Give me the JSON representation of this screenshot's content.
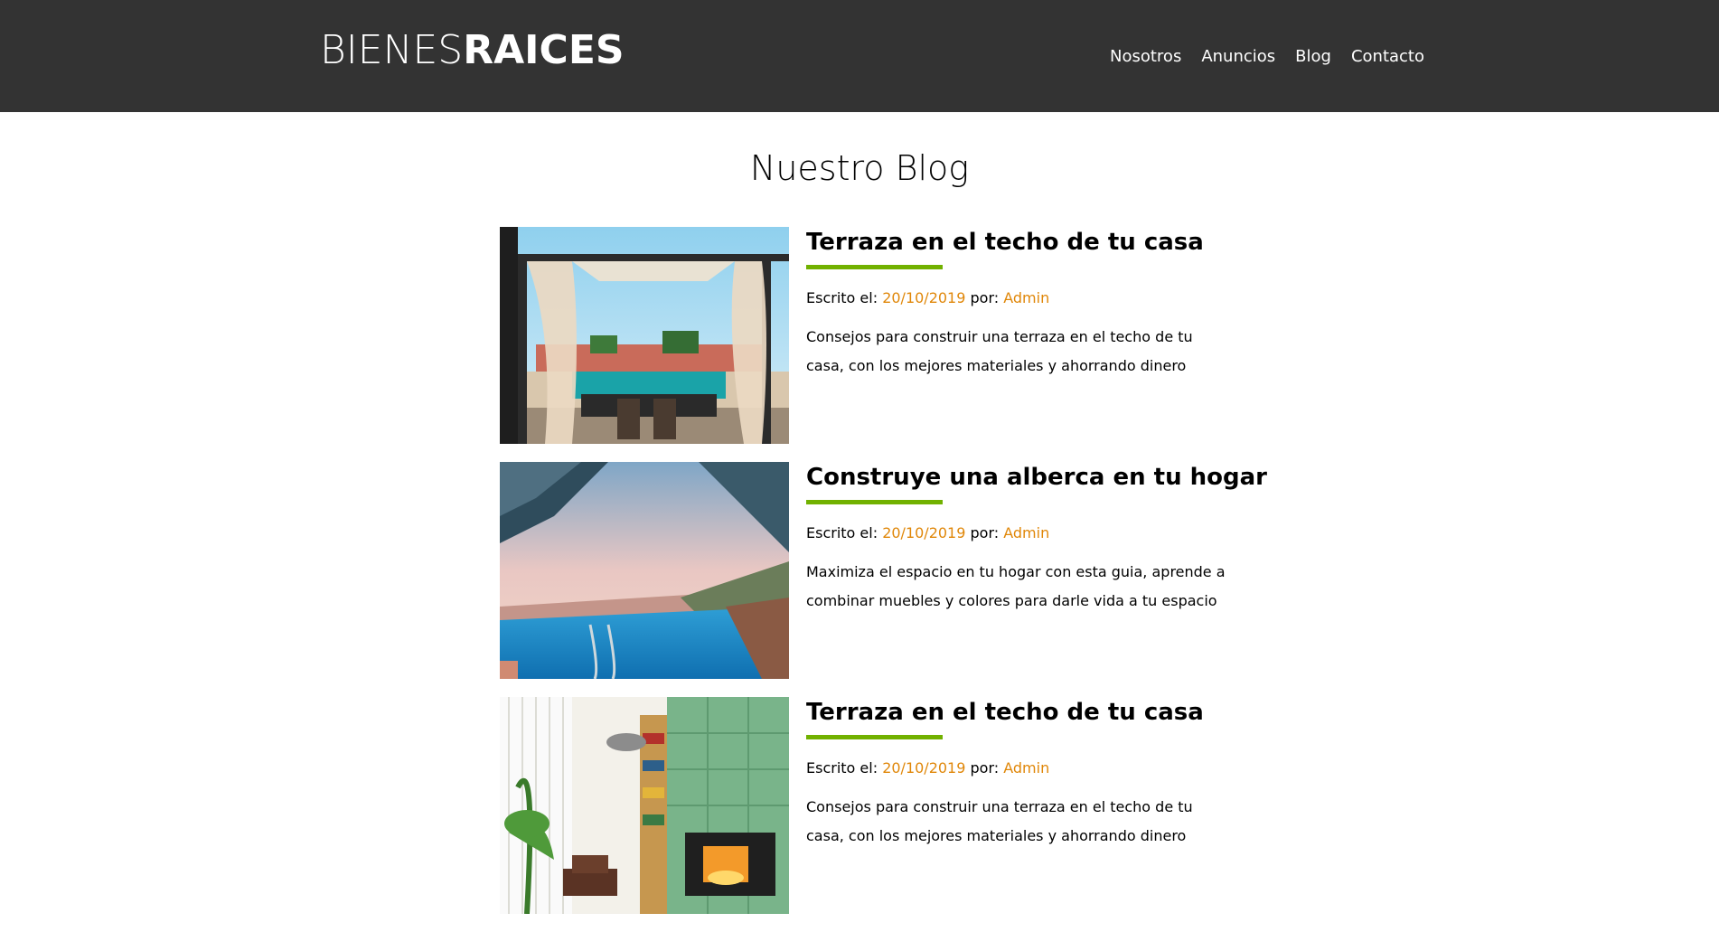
{
  "header": {
    "logo_thin": "BIENES",
    "logo_bold": "RAICES",
    "nav": [
      "Nosotros",
      "Anuncios",
      "Blog",
      "Contacto"
    ]
  },
  "page": {
    "title": "Nuestro Blog"
  },
  "posts": [
    {
      "title": "Terraza en el techo de tu casa",
      "written_label": "Escrito el:",
      "date": "20/10/2019",
      "by_label": "por:",
      "author": "Admin",
      "excerpt": "Consejos para construir una terraza en el techo de tu casa, con los mejores materiales y ahorrando dinero",
      "image": "rooftop-terrace-image"
    },
    {
      "title": "Construye una alberca en tu hogar",
      "written_label": "Escrito el:",
      "date": "20/10/2019",
      "by_label": "por:",
      "author": "Admin",
      "excerpt": "Maximiza el espacio en tu hogar con esta guia, aprende a combinar muebles y colores para darle vida a tu espacio",
      "image": "infinity-pool-image"
    },
    {
      "title": "Terraza en el techo de tu casa",
      "written_label": "Escrito el:",
      "date": "20/10/2019",
      "by_label": "por:",
      "author": "Admin",
      "excerpt": "Consejos para construir una terraza en el techo de tu casa, con los mejores materiales y ahorrando dinero",
      "image": "living-room-image"
    }
  ],
  "colors": {
    "header_bg": "#333333",
    "accent_green": "#71b100",
    "accent_orange": "#e08709"
  }
}
